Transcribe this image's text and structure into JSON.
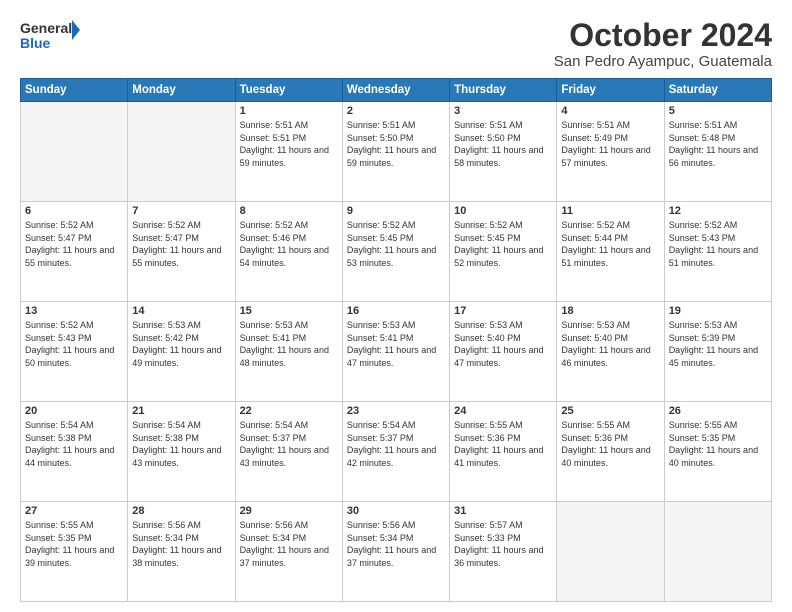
{
  "logo": {
    "line1": "General",
    "line2": "Blue"
  },
  "title": "October 2024",
  "subtitle": "San Pedro Ayampuc, Guatemala",
  "days_header": [
    "Sunday",
    "Monday",
    "Tuesday",
    "Wednesday",
    "Thursday",
    "Friday",
    "Saturday"
  ],
  "weeks": [
    [
      {
        "day": "",
        "sunrise": "",
        "sunset": "",
        "daylight": "",
        "empty": true
      },
      {
        "day": "",
        "sunrise": "",
        "sunset": "",
        "daylight": "",
        "empty": true
      },
      {
        "day": "1",
        "sunrise": "Sunrise: 5:51 AM",
        "sunset": "Sunset: 5:51 PM",
        "daylight": "Daylight: 11 hours and 59 minutes.",
        "empty": false
      },
      {
        "day": "2",
        "sunrise": "Sunrise: 5:51 AM",
        "sunset": "Sunset: 5:50 PM",
        "daylight": "Daylight: 11 hours and 59 minutes.",
        "empty": false
      },
      {
        "day": "3",
        "sunrise": "Sunrise: 5:51 AM",
        "sunset": "Sunset: 5:50 PM",
        "daylight": "Daylight: 11 hours and 58 minutes.",
        "empty": false
      },
      {
        "day": "4",
        "sunrise": "Sunrise: 5:51 AM",
        "sunset": "Sunset: 5:49 PM",
        "daylight": "Daylight: 11 hours and 57 minutes.",
        "empty": false
      },
      {
        "day": "5",
        "sunrise": "Sunrise: 5:51 AM",
        "sunset": "Sunset: 5:48 PM",
        "daylight": "Daylight: 11 hours and 56 minutes.",
        "empty": false
      }
    ],
    [
      {
        "day": "6",
        "sunrise": "Sunrise: 5:52 AM",
        "sunset": "Sunset: 5:47 PM",
        "daylight": "Daylight: 11 hours and 55 minutes.",
        "empty": false
      },
      {
        "day": "7",
        "sunrise": "Sunrise: 5:52 AM",
        "sunset": "Sunset: 5:47 PM",
        "daylight": "Daylight: 11 hours and 55 minutes.",
        "empty": false
      },
      {
        "day": "8",
        "sunrise": "Sunrise: 5:52 AM",
        "sunset": "Sunset: 5:46 PM",
        "daylight": "Daylight: 11 hours and 54 minutes.",
        "empty": false
      },
      {
        "day": "9",
        "sunrise": "Sunrise: 5:52 AM",
        "sunset": "Sunset: 5:45 PM",
        "daylight": "Daylight: 11 hours and 53 minutes.",
        "empty": false
      },
      {
        "day": "10",
        "sunrise": "Sunrise: 5:52 AM",
        "sunset": "Sunset: 5:45 PM",
        "daylight": "Daylight: 11 hours and 52 minutes.",
        "empty": false
      },
      {
        "day": "11",
        "sunrise": "Sunrise: 5:52 AM",
        "sunset": "Sunset: 5:44 PM",
        "daylight": "Daylight: 11 hours and 51 minutes.",
        "empty": false
      },
      {
        "day": "12",
        "sunrise": "Sunrise: 5:52 AM",
        "sunset": "Sunset: 5:43 PM",
        "daylight": "Daylight: 11 hours and 51 minutes.",
        "empty": false
      }
    ],
    [
      {
        "day": "13",
        "sunrise": "Sunrise: 5:52 AM",
        "sunset": "Sunset: 5:43 PM",
        "daylight": "Daylight: 11 hours and 50 minutes.",
        "empty": false
      },
      {
        "day": "14",
        "sunrise": "Sunrise: 5:53 AM",
        "sunset": "Sunset: 5:42 PM",
        "daylight": "Daylight: 11 hours and 49 minutes.",
        "empty": false
      },
      {
        "day": "15",
        "sunrise": "Sunrise: 5:53 AM",
        "sunset": "Sunset: 5:41 PM",
        "daylight": "Daylight: 11 hours and 48 minutes.",
        "empty": false
      },
      {
        "day": "16",
        "sunrise": "Sunrise: 5:53 AM",
        "sunset": "Sunset: 5:41 PM",
        "daylight": "Daylight: 11 hours and 47 minutes.",
        "empty": false
      },
      {
        "day": "17",
        "sunrise": "Sunrise: 5:53 AM",
        "sunset": "Sunset: 5:40 PM",
        "daylight": "Daylight: 11 hours and 47 minutes.",
        "empty": false
      },
      {
        "day": "18",
        "sunrise": "Sunrise: 5:53 AM",
        "sunset": "Sunset: 5:40 PM",
        "daylight": "Daylight: 11 hours and 46 minutes.",
        "empty": false
      },
      {
        "day": "19",
        "sunrise": "Sunrise: 5:53 AM",
        "sunset": "Sunset: 5:39 PM",
        "daylight": "Daylight: 11 hours and 45 minutes.",
        "empty": false
      }
    ],
    [
      {
        "day": "20",
        "sunrise": "Sunrise: 5:54 AM",
        "sunset": "Sunset: 5:38 PM",
        "daylight": "Daylight: 11 hours and 44 minutes.",
        "empty": false
      },
      {
        "day": "21",
        "sunrise": "Sunrise: 5:54 AM",
        "sunset": "Sunset: 5:38 PM",
        "daylight": "Daylight: 11 hours and 43 minutes.",
        "empty": false
      },
      {
        "day": "22",
        "sunrise": "Sunrise: 5:54 AM",
        "sunset": "Sunset: 5:37 PM",
        "daylight": "Daylight: 11 hours and 43 minutes.",
        "empty": false
      },
      {
        "day": "23",
        "sunrise": "Sunrise: 5:54 AM",
        "sunset": "Sunset: 5:37 PM",
        "daylight": "Daylight: 11 hours and 42 minutes.",
        "empty": false
      },
      {
        "day": "24",
        "sunrise": "Sunrise: 5:55 AM",
        "sunset": "Sunset: 5:36 PM",
        "daylight": "Daylight: 11 hours and 41 minutes.",
        "empty": false
      },
      {
        "day": "25",
        "sunrise": "Sunrise: 5:55 AM",
        "sunset": "Sunset: 5:36 PM",
        "daylight": "Daylight: 11 hours and 40 minutes.",
        "empty": false
      },
      {
        "day": "26",
        "sunrise": "Sunrise: 5:55 AM",
        "sunset": "Sunset: 5:35 PM",
        "daylight": "Daylight: 11 hours and 40 minutes.",
        "empty": false
      }
    ],
    [
      {
        "day": "27",
        "sunrise": "Sunrise: 5:55 AM",
        "sunset": "Sunset: 5:35 PM",
        "daylight": "Daylight: 11 hours and 39 minutes.",
        "empty": false
      },
      {
        "day": "28",
        "sunrise": "Sunrise: 5:56 AM",
        "sunset": "Sunset: 5:34 PM",
        "daylight": "Daylight: 11 hours and 38 minutes.",
        "empty": false
      },
      {
        "day": "29",
        "sunrise": "Sunrise: 5:56 AM",
        "sunset": "Sunset: 5:34 PM",
        "daylight": "Daylight: 11 hours and 37 minutes.",
        "empty": false
      },
      {
        "day": "30",
        "sunrise": "Sunrise: 5:56 AM",
        "sunset": "Sunset: 5:34 PM",
        "daylight": "Daylight: 11 hours and 37 minutes.",
        "empty": false
      },
      {
        "day": "31",
        "sunrise": "Sunrise: 5:57 AM",
        "sunset": "Sunset: 5:33 PM",
        "daylight": "Daylight: 11 hours and 36 minutes.",
        "empty": false
      },
      {
        "day": "",
        "sunrise": "",
        "sunset": "",
        "daylight": "",
        "empty": true
      },
      {
        "day": "",
        "sunrise": "",
        "sunset": "",
        "daylight": "",
        "empty": true
      }
    ]
  ]
}
